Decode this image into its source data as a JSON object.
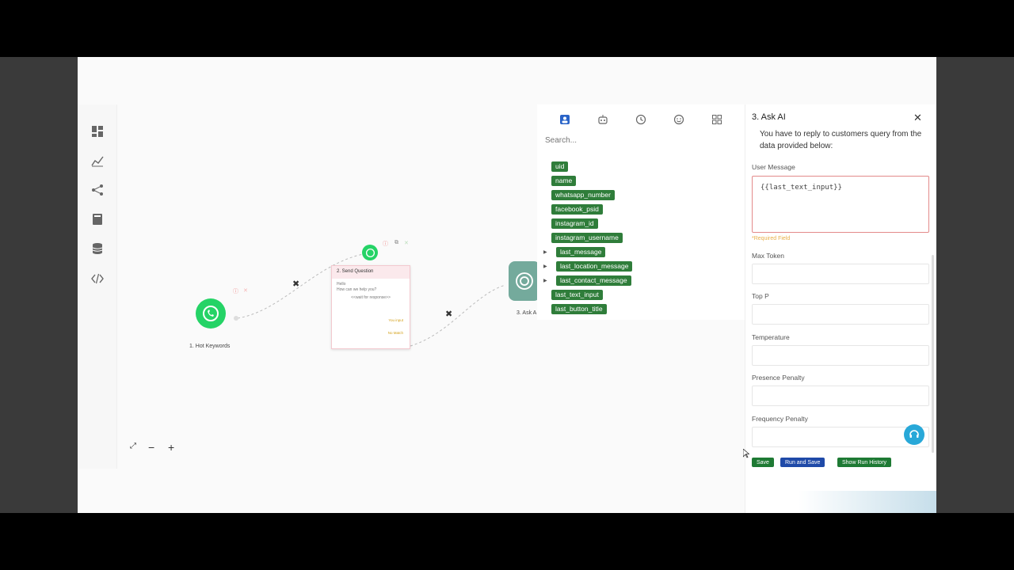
{
  "sidebar": {
    "icons": [
      "dashboard-icon",
      "chart-icon",
      "share-icon",
      "book-icon",
      "database-icon",
      "code-icon"
    ]
  },
  "canvas": {
    "nodes": {
      "hot_keywords": "1. Hot Keywords",
      "send_question": "2. Send Question",
      "ask_ai": "3. Ask A"
    },
    "card": {
      "greeting": "Hello",
      "question": "How can we help you?",
      "waiting": "<<wait for response>>",
      "success": "You input",
      "fallback": "No Match"
    },
    "zoom": {
      "fit": "⤢",
      "minus": "−",
      "plus": "+"
    }
  },
  "variables": {
    "search_placeholder": "Search...",
    "items": [
      {
        "label": "uid",
        "expandable": false
      },
      {
        "label": "name",
        "expandable": false
      },
      {
        "label": "whatsapp_number",
        "expandable": false
      },
      {
        "label": "facebook_psid",
        "expandable": false
      },
      {
        "label": "instagram_id",
        "expandable": false
      },
      {
        "label": "instagram_username",
        "expandable": false
      },
      {
        "label": "last_message",
        "expandable": true
      },
      {
        "label": "last_location_message",
        "expandable": true
      },
      {
        "label": "last_contact_message",
        "expandable": true
      },
      {
        "label": "last_text_input",
        "expandable": false
      },
      {
        "label": "last_button_title",
        "expandable": false
      }
    ]
  },
  "ask_ai": {
    "title": "3. Ask AI",
    "system_message": "You have to reply to customers query from the data provided below:",
    "user_message_label": "User Message",
    "user_message_value": "{{last_text_input}}",
    "required_note": "*Required Field",
    "fields": [
      "Max Token",
      "Top P",
      "Temperature",
      "Presence Penalty",
      "Frequency Penalty"
    ],
    "buttons": {
      "save": "Save",
      "run_save": "Run and Save",
      "history": "Show Run History"
    },
    "colors": {
      "save": "#1e7a34",
      "run_save": "#1f4aa8",
      "history": "#1e7a34"
    }
  }
}
